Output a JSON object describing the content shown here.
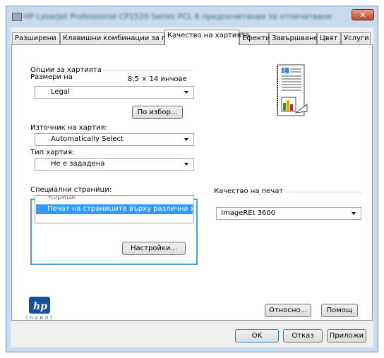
{
  "window": {
    "title": "HP LaserJet Professional CP1520 Series PCL 6 предпочитания за отпечатване",
    "close_label": "✕"
  },
  "tabs": [
    {
      "label": "Разширени"
    },
    {
      "label": "Клавишни комбинации за печат"
    },
    {
      "label": "Качество на хартията"
    },
    {
      "label": "Ефекти"
    },
    {
      "label": "Завършване"
    },
    {
      "label": "Цвят"
    },
    {
      "label": "Услуги"
    }
  ],
  "paper_options": {
    "group_label": "Опции за хартията",
    "size_label": "Размери на",
    "size_value": "8,5 × 14 инчове",
    "size_selected": "Legal",
    "custom_button": "По избор...",
    "source_label": "Източник на хартия:",
    "source_selected": "Automatically Select",
    "type_label": "Тип хартия:",
    "type_selected": "Не е зададена",
    "special_label": "Специални страници:",
    "special_partial": "Корици",
    "special_selected": "Печат на страниците върху различна харти",
    "settings_button": "Настройки..."
  },
  "print_quality": {
    "group_label": "Качество на печат",
    "selected": "ImageREt 3600"
  },
  "logo": {
    "text": "invent"
  },
  "buttons": {
    "about": "Относно...",
    "help": "Помощ",
    "ok": "OK",
    "cancel": "Отказ",
    "apply": "Приложи"
  }
}
